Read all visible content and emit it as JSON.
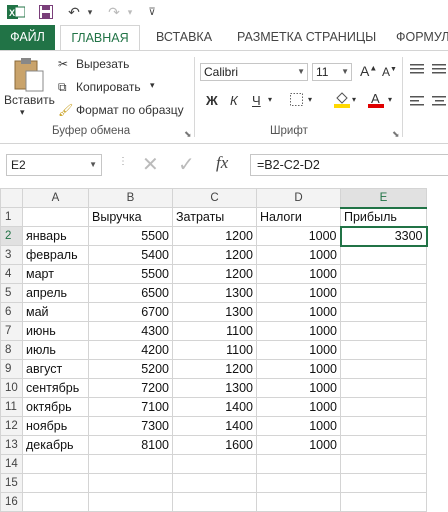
{
  "quick_access": {
    "file_icon": "ФАЙЛ"
  },
  "tabs": [
    "ФАЙЛ",
    "ГЛАВНАЯ",
    "ВСТАВКА",
    "РАЗМЕТКА СТРАНИЦЫ",
    "ФОРМУЛ"
  ],
  "clipboard": {
    "paste_label": "Вставить",
    "cut_label": "Вырезать",
    "copy_label": "Копировать",
    "format_painter_label": "Формат по образцу",
    "group_label": "Буфер обмена"
  },
  "font": {
    "family": "Calibri",
    "size": "11",
    "bold": "Ж",
    "italic": "К",
    "underline": "Ч",
    "group_label": "Шрифт"
  },
  "formula_bar": {
    "name_box": "E2",
    "formula": "=B2-C2-D2"
  },
  "sheet": {
    "columns": [
      "A",
      "B",
      "C",
      "D",
      "E"
    ],
    "selected_column": "E",
    "selected_row": 2,
    "rows": [
      {
        "n": "1",
        "a": "",
        "b": "Выручка",
        "c": "Затраты",
        "d": "Налоги",
        "e": "Прибыль"
      },
      {
        "n": "2",
        "a": "январь",
        "b": "5500",
        "c": "1200",
        "d": "1000",
        "e": "3300"
      },
      {
        "n": "3",
        "a": "февраль",
        "b": "5400",
        "c": "1200",
        "d": "1000",
        "e": ""
      },
      {
        "n": "4",
        "a": "март",
        "b": "5500",
        "c": "1200",
        "d": "1000",
        "e": ""
      },
      {
        "n": "5",
        "a": "апрель",
        "b": "6500",
        "c": "1300",
        "d": "1000",
        "e": ""
      },
      {
        "n": "6",
        "a": "май",
        "b": "6700",
        "c": "1300",
        "d": "1000",
        "e": ""
      },
      {
        "n": "7",
        "a": "июнь",
        "b": "4300",
        "c": "1100",
        "d": "1000",
        "e": ""
      },
      {
        "n": "8",
        "a": "июль",
        "b": "4200",
        "c": "1100",
        "d": "1000",
        "e": ""
      },
      {
        "n": "9",
        "a": "август",
        "b": "5200",
        "c": "1200",
        "d": "1000",
        "e": ""
      },
      {
        "n": "10",
        "a": "сентябрь",
        "b": "7200",
        "c": "1300",
        "d": "1000",
        "e": ""
      },
      {
        "n": "11",
        "a": "октябрь",
        "b": "7100",
        "c": "1400",
        "d": "1000",
        "e": ""
      },
      {
        "n": "12",
        "a": "ноябрь",
        "b": "7300",
        "c": "1400",
        "d": "1000",
        "e": ""
      },
      {
        "n": "13",
        "a": "декабрь",
        "b": "8100",
        "c": "1600",
        "d": "1000",
        "e": ""
      },
      {
        "n": "14",
        "a": "",
        "b": "",
        "c": "",
        "d": "",
        "e": ""
      },
      {
        "n": "15",
        "a": "",
        "b": "",
        "c": "",
        "d": "",
        "e": ""
      },
      {
        "n": "16",
        "a": "",
        "b": "",
        "c": "",
        "d": "",
        "e": ""
      }
    ]
  },
  "colors": {
    "accent": "#217346",
    "border": "#d4d4d4"
  }
}
